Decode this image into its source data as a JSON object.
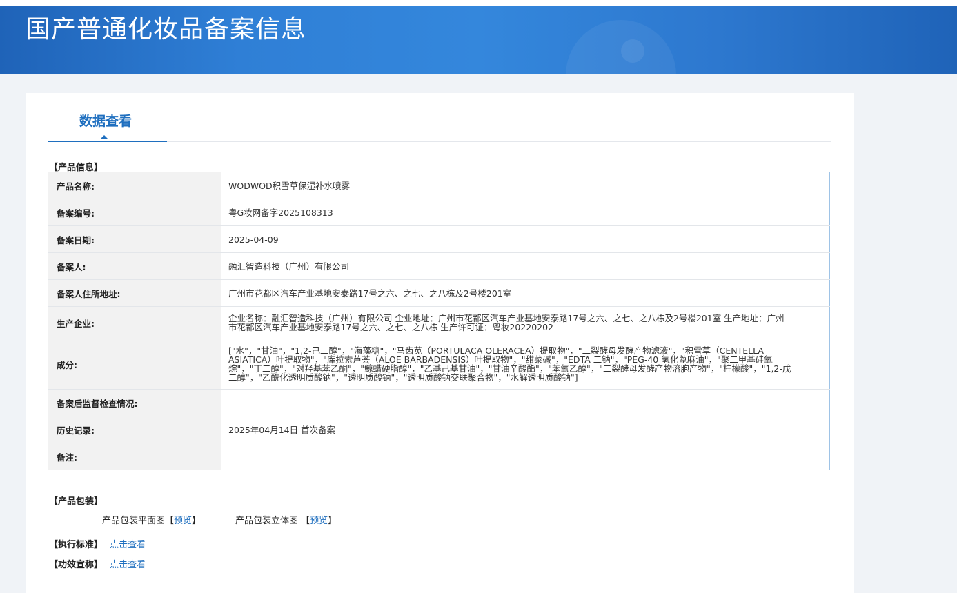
{
  "banner": {
    "title": "国产普通化妆品备案信息"
  },
  "tabs": [
    {
      "label": "数据查看",
      "active": true
    }
  ],
  "product_info": {
    "heading": "【产品信息】",
    "rows": [
      {
        "label": "产品名称:",
        "value": "WODWOD积雪草保湿补水喷雾"
      },
      {
        "label": "备案编号:",
        "value": "粤G妆网备字2025108313"
      },
      {
        "label": "备案日期:",
        "value": "2025-04-09"
      },
      {
        "label": "备案人:",
        "value": "融汇智造科技（广州）有限公司"
      },
      {
        "label": "备案人住所地址:",
        "value": "广州市花都区汽车产业基地安泰路17号之六、之七、之八栋及2号楼201室"
      },
      {
        "label": "生产企业:",
        "value": "企业名称：融汇智造科技（广州）有限公司 企业地址：广州市花都区汽车产业基地安泰路17号之六、之七、之八栋及2号楼201室 生产地址：广州市花都区汽车产业基地安泰路17号之六、之七、之八栋 生产许可证：粤妆20220202"
      },
      {
        "label": "成分:",
        "value": "[\"水\"，\"甘油\"，\"1,2-己二醇\"，\"海藻糖\"，\"马齿苋（PORTULACA OLERACEA）提取物\"，\"二裂酵母发酵产物滤液\"，\"积雪草（CENTELLA ASIATICA）叶提取物\"，\"库拉索芦荟（ALOE BARBADENSIS）叶提取物\"，\"甜菜碱\"，\"EDTA 二钠\"，\"PEG-40 氢化蓖麻油\"，\"聚二甲基硅氧烷\"，\"丁二醇\"，\"对羟基苯乙酮\"，\"鲸蜡硬脂醇\"，\"乙基己基甘油\"，\"甘油辛酸酯\"，\"苯氧乙醇\"，\"二裂酵母发酵产物溶胞产物\"，\"柠檬酸\"，\"1,2-戊二醇\"，\"乙酰化透明质酸钠\"，\"透明质酸钠\"，\"透明质酸钠交联聚合物\"，\"水解透明质酸钠\"]"
      },
      {
        "label": "备案后监督检查情况:",
        "value": ""
      },
      {
        "label": "历史记录:",
        "value": "2025年04月14日 首次备案"
      },
      {
        "label": "备注:",
        "value": ""
      }
    ]
  },
  "packaging": {
    "heading": "【产品包装】",
    "flat_label": "产品包装平面图【",
    "flat_link": "预览",
    "flat_close": "】",
    "solid_label": "产品包装立体图 【",
    "solid_link": "预览",
    "solid_close": "】"
  },
  "standard": {
    "heading": "【执行标准】",
    "link": "点击查看"
  },
  "efficacy": {
    "heading": "【功效宣称】",
    "link": "点击查看"
  }
}
